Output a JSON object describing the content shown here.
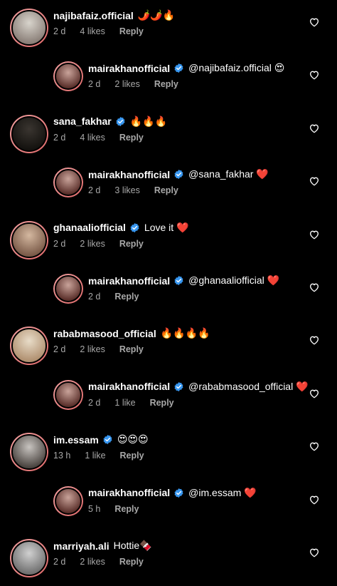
{
  "comments": [
    {
      "type": "top",
      "username": "najibafaiz.official",
      "verified": false,
      "text": "🌶️🌶️🔥",
      "time": "2 d",
      "likes": "4 likes",
      "reply_label": "Reply",
      "avatar_colors": [
        "#d8d4cc",
        "#8a7f78"
      ]
    },
    {
      "type": "reply",
      "username": "mairakhanofficial",
      "verified": true,
      "text": "@najibafaiz.official 😍",
      "time": "2 d",
      "likes": "2 likes",
      "reply_label": "Reply",
      "avatar_colors": [
        "#c9a39a",
        "#5a2f2a"
      ]
    },
    {
      "type": "top",
      "username": "sana_fakhar",
      "verified": true,
      "text": "🔥🔥🔥",
      "time": "2 d",
      "likes": "4 likes",
      "reply_label": "Reply",
      "avatar_colors": [
        "#3a3530",
        "#14120f"
      ]
    },
    {
      "type": "reply",
      "username": "mairakhanofficial",
      "verified": true,
      "text": "@sana_fakhar ❤️",
      "time": "2 d",
      "likes": "3 likes",
      "reply_label": "Reply",
      "avatar_colors": [
        "#c9a39a",
        "#5a2f2a"
      ]
    },
    {
      "type": "top",
      "username": "ghanaaliofficial",
      "verified": true,
      "text": "Love it ❤️",
      "time": "2 d",
      "likes": "2 likes",
      "reply_label": "Reply",
      "avatar_colors": [
        "#d4b8a0",
        "#7a5a48"
      ]
    },
    {
      "type": "reply",
      "username": "mairakhanofficial",
      "verified": true,
      "text": "@ghanaaliofficial ❤️",
      "time": "2 d",
      "likes": "",
      "reply_label": "Reply",
      "avatar_colors": [
        "#c9a39a",
        "#5a2f2a"
      ]
    },
    {
      "type": "top",
      "username": "rababmasood_official",
      "verified": false,
      "text": "🔥🔥🔥🔥",
      "time": "2 d",
      "likes": "2 likes",
      "reply_label": "Reply",
      "avatar_colors": [
        "#e8dcc8",
        "#b09070"
      ]
    },
    {
      "type": "reply",
      "username": "mairakhanofficial",
      "verified": true,
      "text": "@rababmasood_official ❤️",
      "time": "2 d",
      "likes": "1 like",
      "reply_label": "Reply",
      "avatar_colors": [
        "#c9a39a",
        "#5a2f2a"
      ]
    },
    {
      "type": "top",
      "username": "im.essam",
      "verified": true,
      "text": "😍😍😍",
      "time": "13 h",
      "likes": "1 like",
      "reply_label": "Reply",
      "avatar_colors": [
        "#c8c4c0",
        "#4a4440"
      ]
    },
    {
      "type": "reply",
      "username": "mairakhanofficial",
      "verified": true,
      "text": "@im.essam ❤️",
      "time": "5 h",
      "likes": "",
      "reply_label": "Reply",
      "avatar_colors": [
        "#c9a39a",
        "#5a2f2a"
      ]
    },
    {
      "type": "top",
      "username": "marriyah.ali",
      "verified": false,
      "text": "Hottie🍫",
      "time": "2 d",
      "likes": "2 likes",
      "reply_label": "Reply",
      "avatar_colors": [
        "#d0d0d0",
        "#707070"
      ]
    }
  ],
  "colors": {
    "background": "#000000",
    "text": "#ffffff",
    "meta": "#a8a8a8",
    "verified": "#3897f0",
    "story_ring": "#e06a6a"
  },
  "icons": {
    "like": "heart-outline-icon",
    "verified": "verified-badge-icon"
  }
}
